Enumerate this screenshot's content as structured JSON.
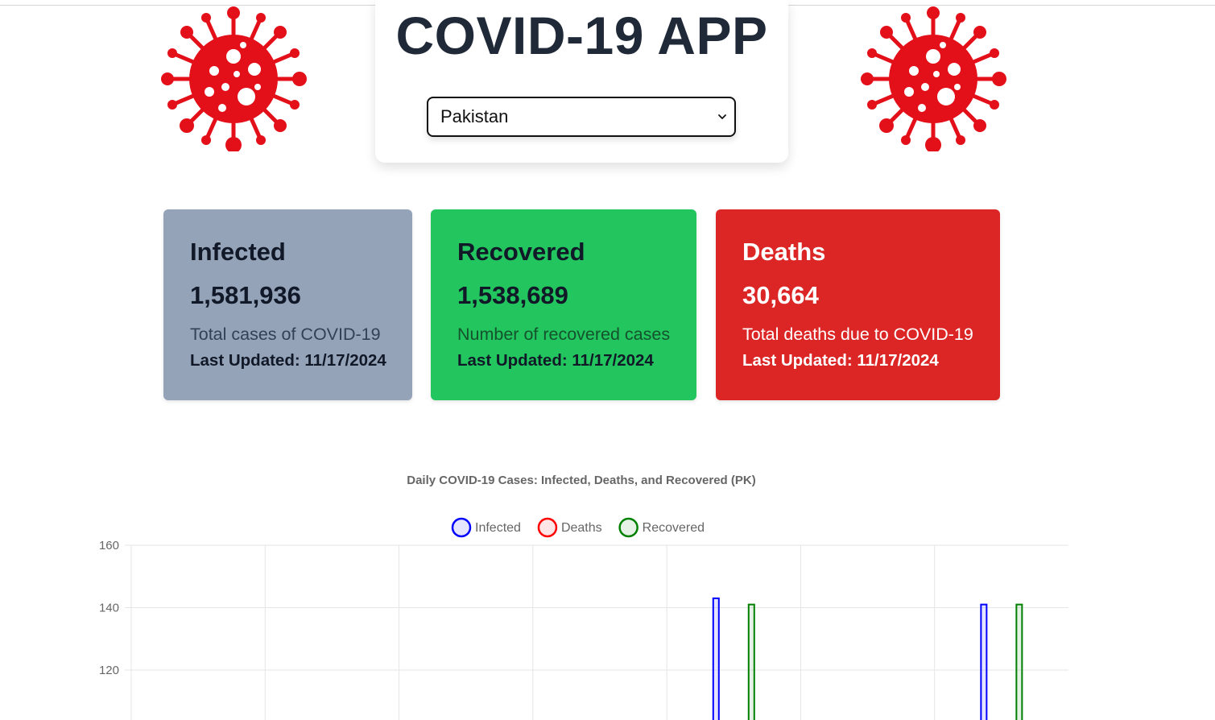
{
  "app": {
    "title": "COVID-19 APP"
  },
  "country_select": {
    "selected": "Pakistan"
  },
  "icons": {
    "virus_left": "virus-icon",
    "virus_right": "virus-icon",
    "select_chevron": "chevron-down-icon"
  },
  "stats": {
    "infected": {
      "title": "Infected",
      "value": "1,581,936",
      "description": "Total cases of COVID-19",
      "updated": "Last Updated: 11/17/2024",
      "color": "#94a3b8"
    },
    "recovered": {
      "title": "Recovered",
      "value": "1,538,689",
      "description": "Number of recovered cases",
      "updated": "Last Updated: 11/17/2024",
      "color": "#22c55e"
    },
    "deaths": {
      "title": "Deaths",
      "value": "30,664",
      "description": "Total deaths due to COVID-19",
      "updated": "Last Updated: 11/17/2024",
      "color": "#dc2626"
    }
  },
  "chart_data": {
    "type": "bar",
    "title": "Daily COVID-19 Cases: Infected, Deaths, and Recovered (PK)",
    "legend_position": "top-center",
    "grid": true,
    "y_ticks": [
      "160",
      "140",
      "120"
    ],
    "ylim": [
      100,
      160
    ],
    "categories_count": 7,
    "series": [
      {
        "name": "Infected",
        "color": "#0000ff",
        "fill": "rgba(0,0,255,0.1)",
        "values": [
          null,
          null,
          null,
          null,
          143,
          null,
          141
        ]
      },
      {
        "name": "Deaths",
        "color": "#ff0000",
        "fill": "rgba(255,0,0,0.1)",
        "values": [
          null,
          null,
          null,
          null,
          null,
          null,
          null
        ]
      },
      {
        "name": "Recovered",
        "color": "#008000",
        "fill": "rgba(0,128,0,0.1)",
        "values": [
          null,
          null,
          null,
          null,
          141,
          null,
          141
        ]
      }
    ]
  }
}
